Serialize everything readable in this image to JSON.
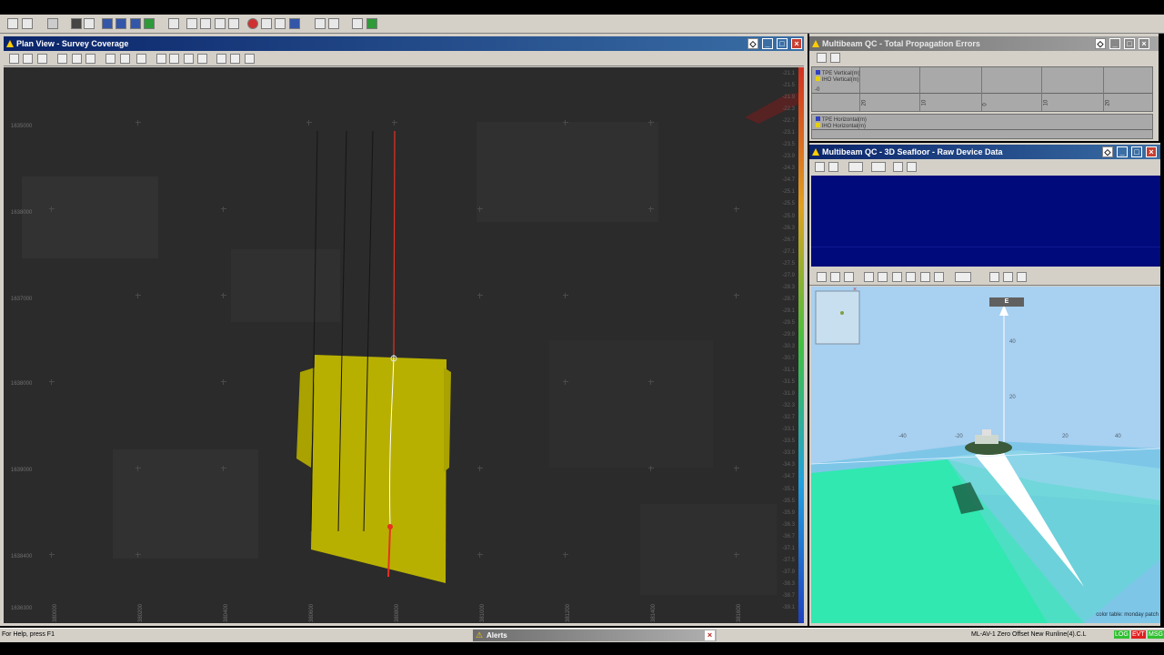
{
  "main_toolbar": {
    "buttons": [
      "file-icon",
      "open-icon",
      "save-icon",
      "print-icon",
      "edit-icon",
      "settings-icon",
      "chart-icon",
      "globe-icon",
      "window-icon",
      "grid-icon",
      "layers-icon",
      "stop-icon",
      "zoom-icon",
      "pan-icon",
      "monitor-icon",
      "tile-icon",
      "cascade-icon",
      "help-icon"
    ]
  },
  "plan_view": {
    "title": "Plan View - Survey Coverage",
    "y_labels": [
      "1635000",
      "1638000",
      "1637000",
      "1638000",
      "1639000",
      "1638400",
      "1636300"
    ],
    "x_labels": [
      "380000",
      "380200",
      "380400",
      "380600",
      "380800",
      "381000",
      "381200",
      "381400",
      "381600"
    ],
    "depth_scale": [
      "-21.1",
      "-21.5",
      "-21.9",
      "-22.3",
      "-22.7",
      "-23.1",
      "-23.5",
      "-23.9",
      "-24.3",
      "-24.7",
      "-25.1",
      "-25.5",
      "-25.9",
      "-26.3",
      "-26.7",
      "-27.1",
      "-27.5",
      "-27.9",
      "-28.3",
      "-28.7",
      "-29.1",
      "-29.5",
      "-29.9",
      "-30.3",
      "-30.7",
      "-31.1",
      "-31.5",
      "-31.9",
      "-32.3",
      "-32.7",
      "-33.1",
      "-33.5",
      "-33.9",
      "-34.3",
      "-34.7",
      "-35.1",
      "-35.5",
      "-35.9",
      "-36.3",
      "-36.7",
      "-37.1",
      "-37.5",
      "-37.9",
      "-38.3",
      "-38.7",
      "-39.1"
    ]
  },
  "tpe_window": {
    "title": "Multibeam QC - Total Propagation Errors",
    "legend_vertical": [
      "TPE Vertical(m)",
      "IHO Vertical(m)"
    ],
    "legend_horizontal": [
      "TPE Horizontal(m)",
      "IHO Horizontal(m)"
    ],
    "axis_values": [
      "-0",
      "20",
      "10",
      "0",
      "10",
      "20"
    ]
  },
  "seafloor_window": {
    "title": "Multibeam QC - 3D Seafloor - Raw Device Data",
    "compass": "E",
    "vertical_labels": [
      "40",
      "20"
    ],
    "horizontal_labels": [
      "-40",
      "-20",
      "20",
      "40"
    ],
    "color_table": "color table: monday patch"
  },
  "status_bar": {
    "help": "For Help, press F1",
    "alerts": "Alerts",
    "right": "ML-AV-1  Zero Offset  New Runline(4).C.L",
    "log": "LOG",
    "evt": "EVT",
    "msg": "MSG"
  },
  "colors": {
    "coverage": "#b8b000",
    "track": "#e83020",
    "panel_blue": "#000a7a",
    "sky": "#a8d0f0",
    "seafloor": "#30e8b0"
  }
}
